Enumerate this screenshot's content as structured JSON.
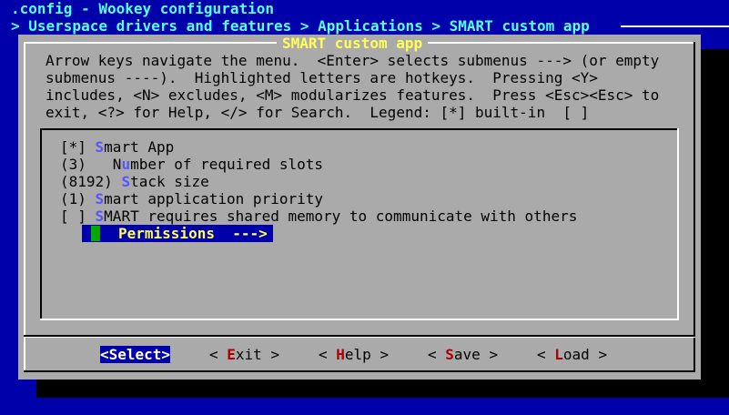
{
  "window": {
    "title": ".config - Wookey configuration",
    "breadcrumb": "> Userspace drivers and features > Applications > SMART custom app"
  },
  "dialog": {
    "title": "SMART custom app",
    "help_lines": [
      "Arrow keys navigate the menu.  <Enter> selects submenus ---> (or empty",
      "submenus ----).  Highlighted letters are hotkeys.  Pressing <Y>",
      "includes, <N> excludes, <M> modularizes features.  Press <Esc><Esc> to",
      "exit, <?> for Help, </> for Search.  Legend: [*] built-in  [ ]"
    ]
  },
  "menu": {
    "items": [
      {
        "prefix": "[*] ",
        "hotkey": "S",
        "rest": "mart App"
      },
      {
        "prefix": "(3)   ",
        "hotkey": "N",
        "pre_hotkey": "",
        "rest": "umber of required slots",
        "display_prefix": "(3)   ",
        "hk_letter_index": 1
      },
      {
        "prefix": "(8192) ",
        "hotkey": "S",
        "rest": "tack size"
      },
      {
        "prefix": "(1) ",
        "hotkey": "S",
        "rest": "mart application priority"
      },
      {
        "prefix": "[ ] ",
        "hotkey": "S",
        "rest": "MART requires shared memory to communicate with others"
      }
    ],
    "item2_parts": {
      "pre": "(3)   N",
      "hotkey": "u",
      "rest": "mber of required slots"
    },
    "selected": {
      "label": "Permissions  --->"
    }
  },
  "buttons": {
    "select": "<Select>",
    "exit": {
      "open": "< ",
      "hotkey": "E",
      "rest": "xit >"
    },
    "help": {
      "open": "< ",
      "hotkey": "H",
      "rest": "elp >"
    },
    "save": {
      "open": "< ",
      "hotkey": "S",
      "rest": "ave >"
    },
    "load": {
      "open": "< ",
      "hotkey": "L",
      "rest": "oad >"
    }
  },
  "colors": {
    "background": "#0000aa",
    "dialog": "#aaaaaa",
    "title_text": "#55ffff",
    "hotkey": "#5555ff",
    "button_hotkey": "#aa0000",
    "selection": "#0000aa",
    "selection_marker": "#00aa00",
    "selection_text": "#ffff55"
  }
}
